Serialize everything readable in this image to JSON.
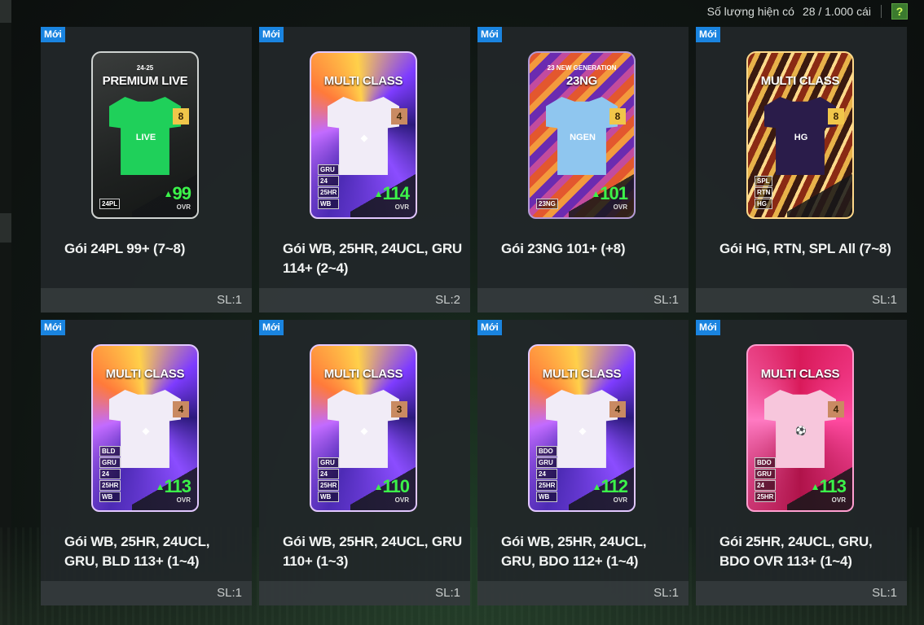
{
  "header": {
    "quantity_label": "Số lượng hiện có",
    "quantity_value": "28 / 1.000 cái",
    "help_label": "?"
  },
  "colors": {
    "new_badge": "#1a84e0",
    "ovr_green": "#3cf24a",
    "help_green": "#3b7a2e"
  },
  "packs": [
    {
      "badge": "Mới",
      "card_style": "premium",
      "card_sub": "24-25",
      "card_title": "PREMIUM LIVE",
      "shirt_color": "#1fd05a",
      "emblem": "LIVE",
      "grade": "8",
      "grade_color": "#f1c64a",
      "ovr": "99",
      "ovr_label": "OVR",
      "tags": [
        "24PL"
      ],
      "name": "Gói 24PL 99+ (7~8)",
      "qty": "SL:1"
    },
    {
      "badge": "Mới",
      "card_style": "multi",
      "card_sub": "",
      "card_title": "MULTI CLASS",
      "shirt_color": "#f1ecf7",
      "emblem": "◆",
      "grade": "4",
      "grade_color": "#c98a62",
      "ovr": "114",
      "ovr_label": "OVR",
      "tags": [
        "GRU",
        "24",
        "25HR",
        "WB"
      ],
      "name": "Gói WB, 25HR, 24UCL, GRU 114+ (2~4)",
      "qty": "SL:2"
    },
    {
      "badge": "Mới",
      "card_style": "ng",
      "card_sub": "23 NEW GENERATION",
      "card_title": "23NG",
      "shirt_color": "#8fc6ef",
      "emblem": "NGEN",
      "grade": "8",
      "grade_color": "#f1c64a",
      "ovr": "101",
      "ovr_label": "OVR",
      "tags": [
        "23NG"
      ],
      "name": "Gói 23NG 101+ (+8)",
      "qty": "SL:1"
    },
    {
      "badge": "Mới",
      "card_style": "gold",
      "card_sub": "",
      "card_title": "MULTI CLASS",
      "shirt_color": "#2a1c4a",
      "emblem": "HG",
      "grade": "8",
      "grade_color": "#f1c64a",
      "ovr": "",
      "ovr_label": "",
      "tags": [
        "SPL",
        "RTN",
        "HG"
      ],
      "name": "Gói HG, RTN, SPL All (7~8)",
      "qty": "SL:1"
    },
    {
      "badge": "Mới",
      "card_style": "multi",
      "card_sub": "",
      "card_title": "MULTI CLASS",
      "shirt_color": "#f1ecf7",
      "emblem": "◆",
      "grade": "4",
      "grade_color": "#c98a62",
      "ovr": "113",
      "ovr_label": "OVR",
      "tags": [
        "BLD",
        "GRU",
        "24",
        "25HR",
        "WB"
      ],
      "name": "Gói WB, 25HR, 24UCL, GRU, BLD 113+ (1~4)",
      "qty": "SL:1"
    },
    {
      "badge": "Mới",
      "card_style": "multi",
      "card_sub": "",
      "card_title": "MULTI CLASS",
      "shirt_color": "#f1ecf7",
      "emblem": "◆",
      "grade": "3",
      "grade_color": "#c98a62",
      "ovr": "110",
      "ovr_label": "OVR",
      "tags": [
        "GRU",
        "24",
        "25HR",
        "WB"
      ],
      "name": "Gói WB, 25HR, 24UCL, GRU 110+ (1~3)",
      "qty": "SL:1"
    },
    {
      "badge": "Mới",
      "card_style": "multi",
      "card_sub": "",
      "card_title": "MULTI CLASS",
      "shirt_color": "#f1ecf7",
      "emblem": "◆",
      "grade": "4",
      "grade_color": "#c98a62",
      "ovr": "112",
      "ovr_label": "OVR",
      "tags": [
        "BDO",
        "GRU",
        "24",
        "25HR",
        "WB"
      ],
      "name": "Gói WB, 25HR, 24UCL, GRU, BDO 112+ (1~4)",
      "qty": "SL:1"
    },
    {
      "badge": "Mới",
      "card_style": "pink",
      "card_sub": "",
      "card_title": "MULTI CLASS",
      "shirt_color": "#f7c6dc",
      "emblem": "⚽",
      "grade": "4",
      "grade_color": "#c98a62",
      "ovr": "113",
      "ovr_label": "OVR",
      "tags": [
        "BDO",
        "GRU",
        "24",
        "25HR"
      ],
      "name": "Gói 25HR, 24UCL, GRU, BDO OVR 113+ (1~4)",
      "qty": "SL:1"
    }
  ]
}
